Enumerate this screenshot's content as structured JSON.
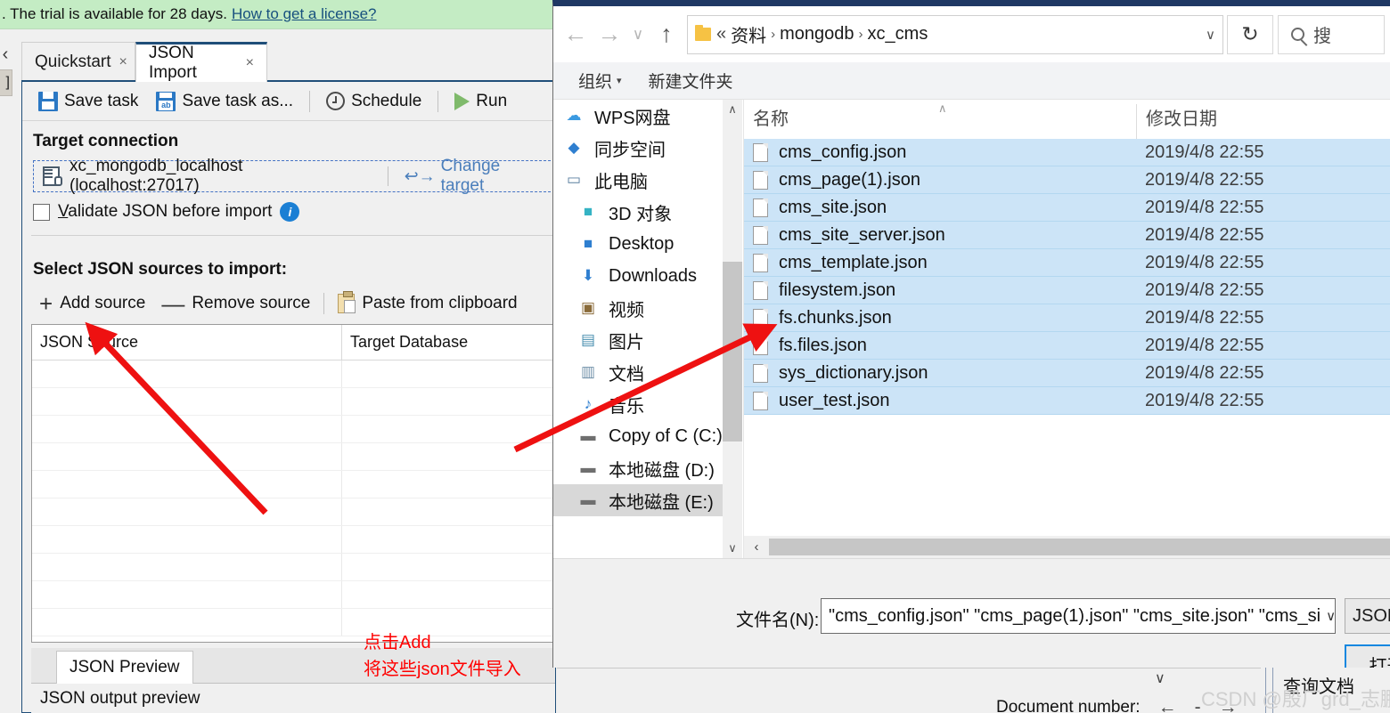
{
  "app": {
    "trial_banner": ". The trial is available for 28 days.",
    "trial_link": "How to get a license?",
    "collapse_chevron": "‹",
    "stub_label": "]",
    "tabs": [
      {
        "label": "Quickstart",
        "close": "×"
      },
      {
        "label": "JSON Import",
        "close": "×"
      }
    ],
    "toolbar": {
      "save_task": "Save task",
      "save_task_as": "Save task as...",
      "schedule": "Schedule",
      "run": "Run"
    },
    "target_connection": {
      "title": "Target connection",
      "value": "xc_mongodb_localhost (localhost:27017)",
      "change_label": "Change target",
      "change_icon": "↩→"
    },
    "validate": {
      "label_pre": "",
      "label_accel": "V",
      "label_post": "alidate JSON before import",
      "info_icon": "i"
    },
    "sources": {
      "title": "Select JSON sources to import:",
      "add": "Add source",
      "remove": "Remove source",
      "paste": "Paste from clipboard",
      "plus": "+",
      "minus": "—",
      "columns": [
        "JSON Source",
        "Target Database"
      ]
    },
    "annotation": "点击Add\n将这些json文件导入",
    "preview": {
      "tab": "JSON Preview",
      "body": "JSON output preview"
    }
  },
  "explorer": {
    "nav": {
      "back": "←",
      "forward": "→",
      "recent": "∨",
      "up": "↑",
      "refresh": "↻"
    },
    "address": {
      "lead": "«",
      "crumbs": [
        "资料",
        "mongodb",
        "xc_cms"
      ],
      "separator": "›",
      "caret": "∨"
    },
    "search": {
      "placeholder": "搜"
    },
    "command_bar": {
      "organize": "组织",
      "organize_caret": "▾",
      "new_folder": "新建文件夹"
    },
    "tree": [
      {
        "label": "WPS网盘",
        "icon": "cloud-icon",
        "glyph": "☁",
        "indent": 0,
        "selected": false,
        "color": "#3b9ae1"
      },
      {
        "label": "同步空间",
        "icon": "sync-icon",
        "glyph": "◆",
        "indent": 0,
        "selected": false,
        "color": "#2f7fd0"
      },
      {
        "label": "此电脑",
        "icon": "this-pc-icon",
        "glyph": "▭",
        "indent": 0,
        "selected": false,
        "color": "#5a7fa0"
      },
      {
        "label": "3D 对象",
        "icon": "3d-objects-icon",
        "glyph": "■",
        "indent": 1,
        "selected": false,
        "color": "#35b3c4"
      },
      {
        "label": "Desktop",
        "icon": "desktop-icon",
        "glyph": "■",
        "indent": 1,
        "selected": false,
        "color": "#2f7fd0"
      },
      {
        "label": "Downloads",
        "icon": "downloads-icon",
        "glyph": "⬇",
        "indent": 1,
        "selected": false,
        "color": "#2f7fd0"
      },
      {
        "label": "视频",
        "icon": "videos-icon",
        "glyph": "▣",
        "indent": 1,
        "selected": false,
        "color": "#8a6b3a"
      },
      {
        "label": "图片",
        "icon": "pictures-icon",
        "glyph": "▤",
        "indent": 1,
        "selected": false,
        "color": "#4a8fb0"
      },
      {
        "label": "文档",
        "icon": "documents-icon",
        "glyph": "▥",
        "indent": 1,
        "selected": false,
        "color": "#6f8fa8"
      },
      {
        "label": "音乐",
        "icon": "music-icon",
        "glyph": "♪",
        "indent": 1,
        "selected": false,
        "color": "#2f7fd0"
      },
      {
        "label": "Copy of C (C:)",
        "icon": "drive-icon",
        "glyph": "▬",
        "indent": 1,
        "selected": false,
        "color": "#6f6f6f"
      },
      {
        "label": "本地磁盘 (D:)",
        "icon": "drive-icon",
        "glyph": "▬",
        "indent": 1,
        "selected": false,
        "color": "#6f6f6f"
      },
      {
        "label": "本地磁盘 (E:)",
        "icon": "drive-icon",
        "glyph": "▬",
        "indent": 1,
        "selected": true,
        "color": "#6f6f6f"
      }
    ],
    "tree_scroll": {
      "up": "∧",
      "down": "∨"
    },
    "list": {
      "columns": [
        "名称",
        "修改日期"
      ],
      "sort_caret": "∧",
      "rows": [
        {
          "name": "cms_config.json",
          "date": "2019/4/8 22:55"
        },
        {
          "name": "cms_page(1).json",
          "date": "2019/4/8 22:55"
        },
        {
          "name": "cms_site.json",
          "date": "2019/4/8 22:55"
        },
        {
          "name": "cms_site_server.json",
          "date": "2019/4/8 22:55"
        },
        {
          "name": "cms_template.json",
          "date": "2019/4/8 22:55"
        },
        {
          "name": "filesystem.json",
          "date": "2019/4/8 22:55"
        },
        {
          "name": "fs.chunks.json",
          "date": "2019/4/8 22:55"
        },
        {
          "name": "fs.files.json",
          "date": "2019/4/8 22:55"
        },
        {
          "name": "sys_dictionary.json",
          "date": "2019/4/8 22:55"
        },
        {
          "name": "user_test.json",
          "date": "2019/4/8 22:55"
        }
      ]
    },
    "hscroll": {
      "left_arrow": "‹"
    },
    "footer": {
      "filename_label": "文件名(N):",
      "filename_value": "\"cms_config.json\" \"cms_page(1).json\" \"cms_site.json\" \"cms_si",
      "filename_caret": "∨",
      "filetype_value": "JSON Te",
      "open_button": "打开"
    }
  },
  "background": {
    "caret": "∨",
    "document_number_label": "Document number:",
    "nav_prev": "←",
    "nav_dash": "-",
    "nav_next": "→",
    "query_doc": "查询文档"
  },
  "watermark": "CSDN @殷厂grd_志鹏",
  "colors": {
    "accent": "#1f4e79",
    "trial_bg": "#c4ecc4",
    "selection": "#cce4f7",
    "annotation": "#ff0000",
    "link": "#4a7ebb"
  }
}
